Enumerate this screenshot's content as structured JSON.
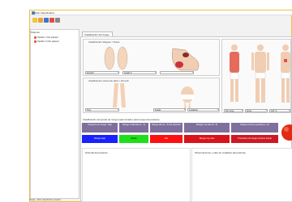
{
  "window": {
    "title": "Risk Classification"
  },
  "toolbar": {
    "icons": [
      "new-icon",
      "open-icon",
      "save-icon",
      "delete-icon",
      "print-icon"
    ]
  },
  "sidebar": {
    "title": "Patients",
    "items": [
      {
        "label": "Tadefo I risk patient"
      },
      {
        "label": "Tadefo II risk patient"
      }
    ]
  },
  "tab": {
    "label": "Clasificación del riesgo"
  },
  "panels": {
    "feet": {
      "title": "Clasificación Wagner / Texas",
      "left_select": "Zona B",
      "right_select": "Grado 0"
    },
    "legs": {
      "title": "Clasificación ulcera de talón / Zona B",
      "left_select": "Tipo",
      "right_select": "Grado",
      "extra_select": "Localizac."
    },
    "body": {
      "select_left": "Sin zona",
      "select_mid": "Zona",
      "select_right": "ALT: 0"
    }
  },
  "grid": {
    "title": "Clasificación del grado de riesgo (aproximado) para riesgo del paciente",
    "headers": [
      "Categoría de riesgo / bajo",
      "Riesgo moderado (1 - 3)",
      "Riesgo alto (4 - 6) del paciente",
      "Riesgo muy alto (6 - 8)",
      "Riesgo extremo (pasado) (> 9)"
    ],
    "values": [
      "Riesgo bajo",
      "Medio",
      "Alto",
      "Riesgo muy alto",
      "Pronóstico de riesgo extremo actual"
    ],
    "colors": [
      "#1a21ff",
      "#1ee01a",
      "#ff1010",
      "#d8141a",
      "#cc1a24"
    ]
  },
  "bottom": {
    "left_label": "Historial del paciente",
    "right_label": "Observaciones y plan de cuidados del paciente"
  },
  "status": {
    "text": "Ready - Risk classification loaded"
  },
  "accent": "#e8c24a"
}
